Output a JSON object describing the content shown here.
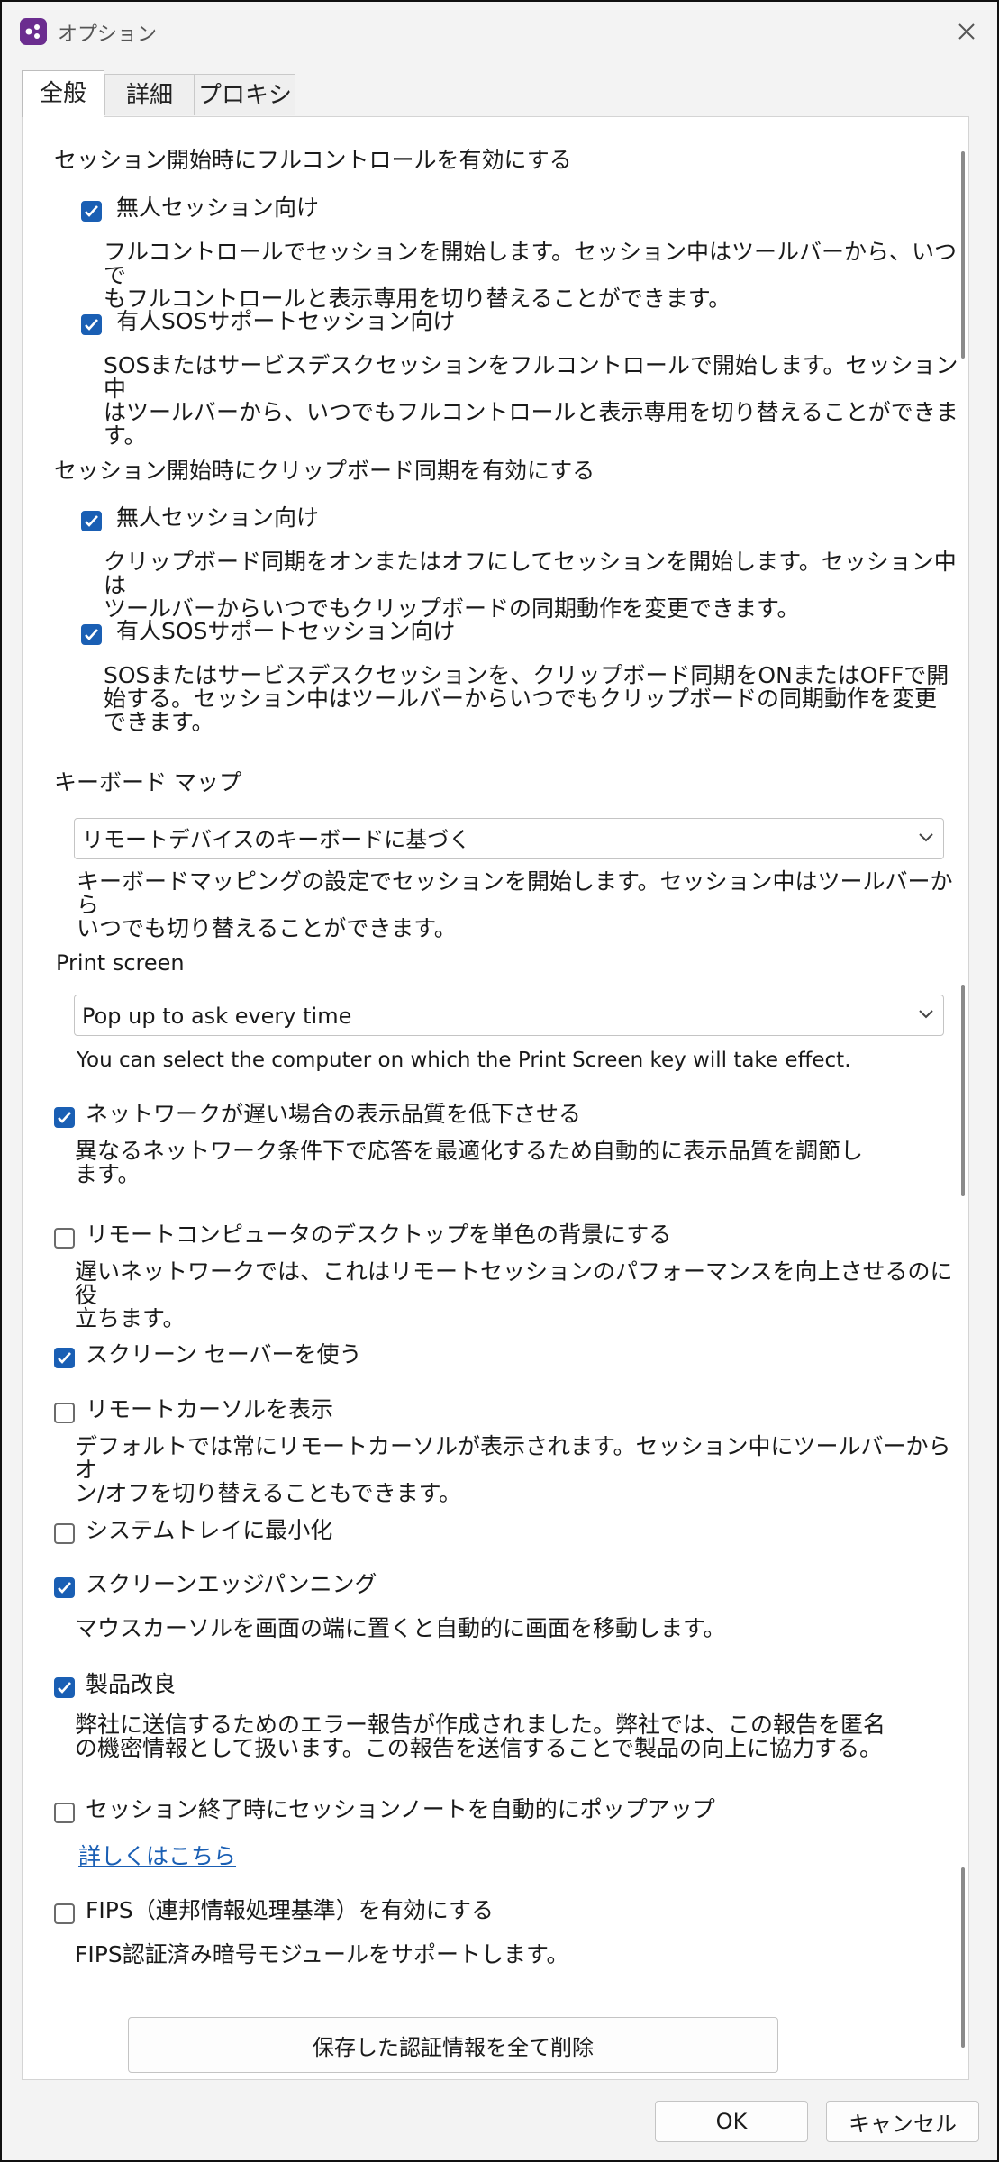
{
  "window": {
    "title": "オプション"
  },
  "tabs": [
    {
      "label": "全般",
      "active": true
    },
    {
      "label": "詳細",
      "active": false
    },
    {
      "label": "プロキシ",
      "active": false
    }
  ],
  "full_control": {
    "heading": "セッション開始時にフルコントロールを有効にする",
    "unattended": {
      "label": "無人セッション向け",
      "checked": true,
      "desc_line1": "フルコントロールでセッションを開始します。セッション中はツールバーから、いつで",
      "desc_line2": "もフルコントロールと表示専用を切り替えることができます。"
    },
    "attended": {
      "label": "有人SOSサポートセッション向け",
      "checked": true,
      "desc_line1": "SOSまたはサービスデスクセッションをフルコントロールで開始します。セッション中",
      "desc_line2": "はツールバーから、いつでもフルコントロールと表示専用を切り替えることができま",
      "desc_line3": "す。"
    }
  },
  "clipboard": {
    "heading": "セッション開始時にクリップボード同期を有効にする",
    "unattended": {
      "label": "無人セッション向け",
      "checked": true,
      "desc_line1": "クリップボード同期をオンまたはオフにしてセッションを開始します。セッション中は",
      "desc_line2": "ツールバーからいつでもクリップボードの同期動作を変更できます。"
    },
    "attended": {
      "label": "有人SOSサポートセッション向け",
      "checked": true,
      "desc_line1": "SOSまたはサービスデスクセッションを、クリップボード同期をONまたはOFFで開",
      "desc_line2": "始する。セッション中はツールバーからいつでもクリップボードの同期動作を変更",
      "desc_line3": "できます。"
    }
  },
  "keyboard_map": {
    "heading": "キーボード マップ",
    "selected": "リモートデバイスのキーボードに基づく",
    "desc_line1": "キーボードマッピングの設定でセッションを開始します。セッション中はツールバーから",
    "desc_line2": "いつでも切り替えることができます。"
  },
  "print_screen": {
    "heading": "Print screen",
    "selected": "Pop up to ask every time",
    "desc": "You can select the computer on which the Print Screen key will take effect."
  },
  "options": {
    "low_bandwidth": {
      "label": "ネットワークが遅い場合の表示品質を低下させる",
      "checked": true,
      "desc_line1": "異なるネットワーク条件下で応答を最適化するため自動的に表示品質を調節し",
      "desc_line2": "ます。"
    },
    "solid_background": {
      "label": "リモートコンピュータのデスクトップを単色の背景にする",
      "checked": false,
      "desc_line1": "遅いネットワークでは、これはリモートセッションのパフォーマンスを向上させるのに役",
      "desc_line2": "立ちます。"
    },
    "screensaver": {
      "label": "スクリーン セーバーを使う",
      "checked": true
    },
    "remote_cursor": {
      "label": "リモートカーソルを表示",
      "checked": false,
      "desc_line1": "デフォルトでは常にリモートカーソルが表示されます。セッション中にツールバーからオ",
      "desc_line2": "ン/オフを切り替えることもできます。"
    },
    "minimize_tray": {
      "label": "システムトレイに最小化",
      "checked": false
    },
    "edge_panning": {
      "label": "スクリーンエッジパンニング",
      "checked": true,
      "desc": "マウスカーソルを画面の端に置くと自動的に画面を移動します。"
    },
    "product_improvement": {
      "label": "製品改良",
      "checked": true,
      "desc_line1": "弊社に送信するためのエラー報告が作成されました。弊社では、この報告を匿名",
      "desc_line2": "の機密情報として扱います。この報告を送信することで製品の向上に協力する。"
    },
    "session_notes": {
      "label": "セッション終了時にセッションノートを自動的にポップアップ",
      "checked": false,
      "link": "詳しくはこちら"
    },
    "fips": {
      "label": "FIPS（連邦情報処理基準）を有効にする",
      "checked": false,
      "desc": "FIPS認証済み暗号モジュールをサポートします。"
    }
  },
  "clear_credentials_button": "保存した認証情報を全て削除",
  "footer": {
    "ok": "OK",
    "cancel": "キャンセル"
  }
}
